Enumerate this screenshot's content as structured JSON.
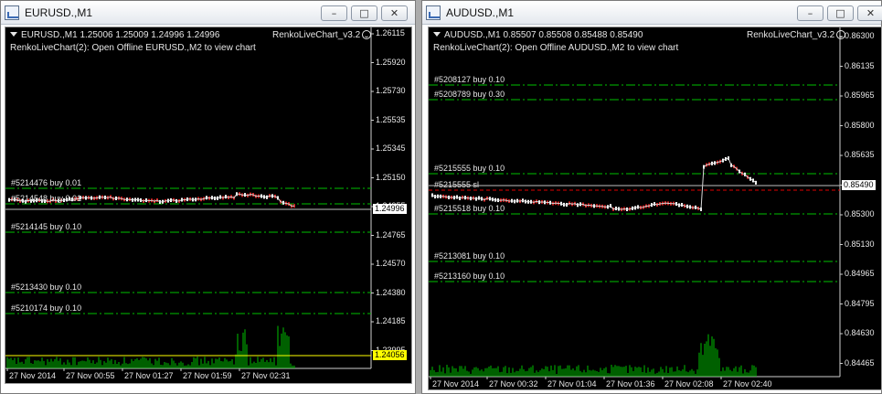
{
  "left_window": {
    "title": "EURUSD.,M1",
    "info_line": "EURUSD.,M1  1.25006 1.25009 1.24996 1.24996",
    "indicator_line": "RenkoLiveChart(2): Open Offline EURUSD.,M2 to view chart",
    "indicator_name": "RenkoLiveChart_v3.2",
    "price_scale": [
      "1.26115",
      "1.25920",
      "1.25730",
      "1.25535",
      "1.25345",
      "1.25150",
      "1.24955",
      "1.24765",
      "1.24570",
      "1.24380",
      "1.24185",
      "1.23995"
    ],
    "current_price_tag": "1.24996",
    "volume_price_tag": "1.24056",
    "time_labels": [
      "27 Nov 2014",
      "27 Nov 00:55",
      "27 Nov 01:27",
      "27 Nov 01:59",
      "27 Nov 02:31"
    ],
    "orders": [
      "#5214476 buy 0.01",
      "#5214548 buy 0.01",
      "#5214145 buy 0.10",
      "#5213430 buy 0.10",
      "#5210174 buy 0.10"
    ]
  },
  "right_window": {
    "title": "AUDUSD.,M1",
    "info_line": "AUDUSD.,M1  0.85507 0.85508 0.85488 0.85490",
    "indicator_line": "RenkoLiveChart(2): Open Offline AUDUSD.,M2 to view chart",
    "indicator_name": "RenkoLiveChart_v3.2",
    "price_scale": [
      "0.86300",
      "0.86135",
      "0.85965",
      "0.85800",
      "0.85635",
      "0.85465",
      "0.85300",
      "0.85130",
      "0.84965",
      "0.84795",
      "0.84630",
      "0.84465"
    ],
    "current_price_tag": "0.85490",
    "time_labels": [
      "27 Nov 2014",
      "27 Nov 00:32",
      "27 Nov 01:04",
      "27 Nov 01:36",
      "27 Nov 02:08",
      "27 Nov 02:40"
    ],
    "orders": [
      "#5208127 buy 0.10",
      "#5208789 buy 0.30",
      "#5215555 buy 0.10",
      "#5215555 sl",
      "#5215518 buy 0.10",
      "#5213081 buy 0.10",
      "#5213160 buy 0.10"
    ]
  },
  "window_buttons": {
    "minimize": "–",
    "maximize": "□",
    "close": "✕"
  },
  "colors": {
    "background": "#000000",
    "order_line": "#00c000",
    "sl_line": "#e00000",
    "volume": "#00c000",
    "bid_line": "#c0c0c0",
    "volume_tag": "#ffff00"
  }
}
